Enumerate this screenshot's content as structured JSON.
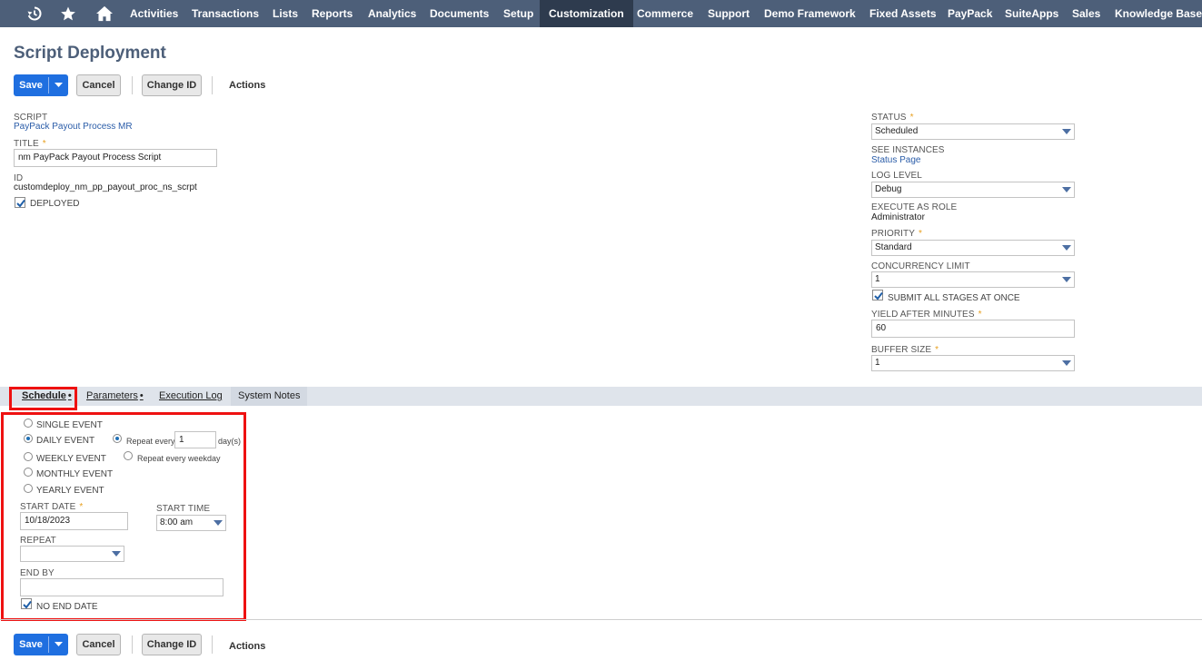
{
  "nav": {
    "items": [
      "Activities",
      "Transactions",
      "Lists",
      "Reports",
      "Analytics",
      "Documents",
      "Setup",
      "Customization",
      "Commerce",
      "Support",
      "Demo Framework",
      "Fixed Assets",
      "PayPack",
      "SuiteApps",
      "Sales",
      "Knowledge Base"
    ],
    "active": "Customization"
  },
  "page": {
    "title": "Script Deployment"
  },
  "toolbar": {
    "save": "Save",
    "cancel": "Cancel",
    "change_id": "Change ID",
    "actions": "Actions"
  },
  "main": {
    "script": {
      "label": "SCRIPT",
      "value": "PayPack Payout Process MR"
    },
    "title": {
      "label": "TITLE",
      "value": "nm PayPack Payout Process Script"
    },
    "id": {
      "label": "ID",
      "value": "customdeploy_nm_pp_payout_proc_ns_scrpt"
    },
    "deployed": {
      "label": "DEPLOYED",
      "checked": true
    }
  },
  "side": {
    "status": {
      "label": "STATUS",
      "value": "Scheduled"
    },
    "see_instances": {
      "label": "SEE INSTANCES",
      "value": "Status Page"
    },
    "log_level": {
      "label": "LOG LEVEL",
      "value": "Debug"
    },
    "execute_as_role": {
      "label": "EXECUTE AS ROLE",
      "value": "Administrator"
    },
    "priority": {
      "label": "PRIORITY",
      "value": "Standard"
    },
    "concurrency_limit": {
      "label": "CONCURRENCY LIMIT",
      "value": "1"
    },
    "submit_all_stages": {
      "label": "SUBMIT ALL STAGES AT ONCE",
      "checked": true
    },
    "yield_after_minutes": {
      "label": "YIELD AFTER MINUTES",
      "value": "60"
    },
    "buffer_size": {
      "label": "BUFFER SIZE",
      "value": "1"
    }
  },
  "tabs": {
    "schedule": "Schedule",
    "parameters": "Parameters",
    "execution_log": "Execution Log",
    "system_notes": "System Notes",
    "dot": "•"
  },
  "schedule": {
    "single_event": "SINGLE EVENT",
    "daily_event": "DAILY EVENT",
    "weekly_event": "WEEKLY EVENT",
    "monthly_event": "MONTHLY EVENT",
    "yearly_event": "YEARLY EVENT",
    "selected_event": "DAILY EVENT",
    "repeat_every_label": "Repeat every",
    "repeat_every_value": "1",
    "days_unit": "day(s)",
    "repeat_every_weekday": "Repeat every weekday",
    "start_date": {
      "label": "START DATE",
      "value": "10/18/2023"
    },
    "start_time": {
      "label": "START TIME",
      "value": "8:00 am"
    },
    "repeat": {
      "label": "REPEAT",
      "value": ""
    },
    "end_by": {
      "label": "END BY",
      "value": ""
    },
    "no_end_date": {
      "label": "NO END DATE",
      "checked": true
    }
  },
  "colors": {
    "nav_bg": "#4d5f79",
    "nav_active": "#2e3b4e",
    "primary": "#1f6fe0",
    "link": "#2a5ca8",
    "highlight": "#ee1111",
    "required": "#e8a020"
  }
}
